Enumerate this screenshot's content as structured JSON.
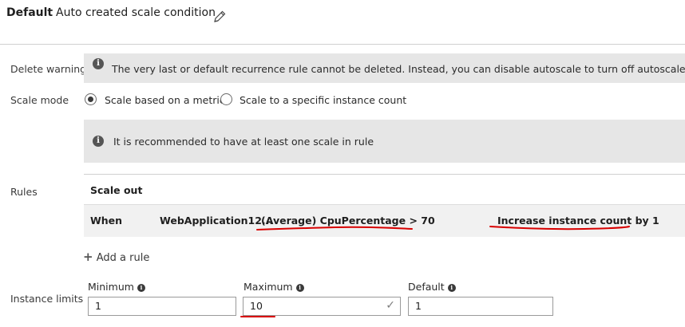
{
  "header": {
    "profile_label": "Default",
    "profile_name": "Auto created scale condition"
  },
  "delete_warning": {
    "label": "Delete warning",
    "message": "The very last or default recurrence rule cannot be deleted. Instead, you can disable autoscale to turn off autoscale."
  },
  "scale_mode": {
    "label": "Scale mode",
    "options": [
      {
        "label": "Scale based on a metric",
        "selected": true
      },
      {
        "label": "Scale to a specific instance count",
        "selected": false
      }
    ]
  },
  "recommend_banner": {
    "message": "It is recommended to have at least one scale in rule"
  },
  "rules": {
    "label": "Rules",
    "section_title": "Scale out",
    "row": {
      "when": "When",
      "resource": "WebApplication12...",
      "condition": "(Average) CpuPercentage > 70",
      "action": "Increase instance count by 1"
    },
    "add_rule": "Add a rule"
  },
  "instance_limits": {
    "label": "Instance limits",
    "minimum": {
      "label": "Minimum",
      "value": "1"
    },
    "maximum": {
      "label": "Maximum",
      "value": "10"
    },
    "default": {
      "label": "Default",
      "value": "1"
    }
  },
  "colors": {
    "annotation_red": "#d80000",
    "banner_bg": "#e6e6e6"
  }
}
